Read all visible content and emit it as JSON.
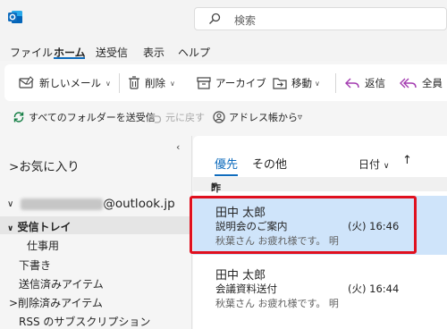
{
  "search": {
    "placeholder": "検索"
  },
  "menu": {
    "items": [
      "ファイル",
      "ホーム",
      "送受信",
      "表示",
      "ヘルプ"
    ],
    "active": "ホーム"
  },
  "ribbon": {
    "new_mail": "新しいメール",
    "delete": "削除",
    "archive": "アーカイブ",
    "move": "移動",
    "reply": "返信",
    "reply_all": "全員"
  },
  "toolbar2": {
    "send_receive_all": "すべてのフォルダーを送受信",
    "undo": "元に戻す",
    "address_book": "アドレス帳から"
  },
  "folders": {
    "favorites": "お気に入り",
    "account_suffix": "@outlook.jp",
    "inbox": "受信トレイ",
    "subfolder": "仕事用",
    "drafts": "下書き",
    "sent": "送信済みアイテム",
    "deleted": "削除済みアイテム",
    "rss": "RSS のサブスクリプション"
  },
  "list": {
    "tab_focused": "優先",
    "tab_other": "その他",
    "sort_label": "日付",
    "group": "昨日",
    "messages": [
      {
        "from": "田中 太郎",
        "subject": "説明会のご案内",
        "date": "(火) 16:46",
        "preview": "秋葉さん お疲れ様です。 明",
        "selected": true
      },
      {
        "from": "田中 太郎",
        "subject": "会議資料送付",
        "date": "(火) 16:44",
        "preview": "秋葉さん お疲れ様です。 明",
        "selected": false
      }
    ]
  },
  "colors": {
    "accent": "#0f6cbd",
    "selection": "#cfe4fa",
    "highlight_border": "#e0101f"
  }
}
